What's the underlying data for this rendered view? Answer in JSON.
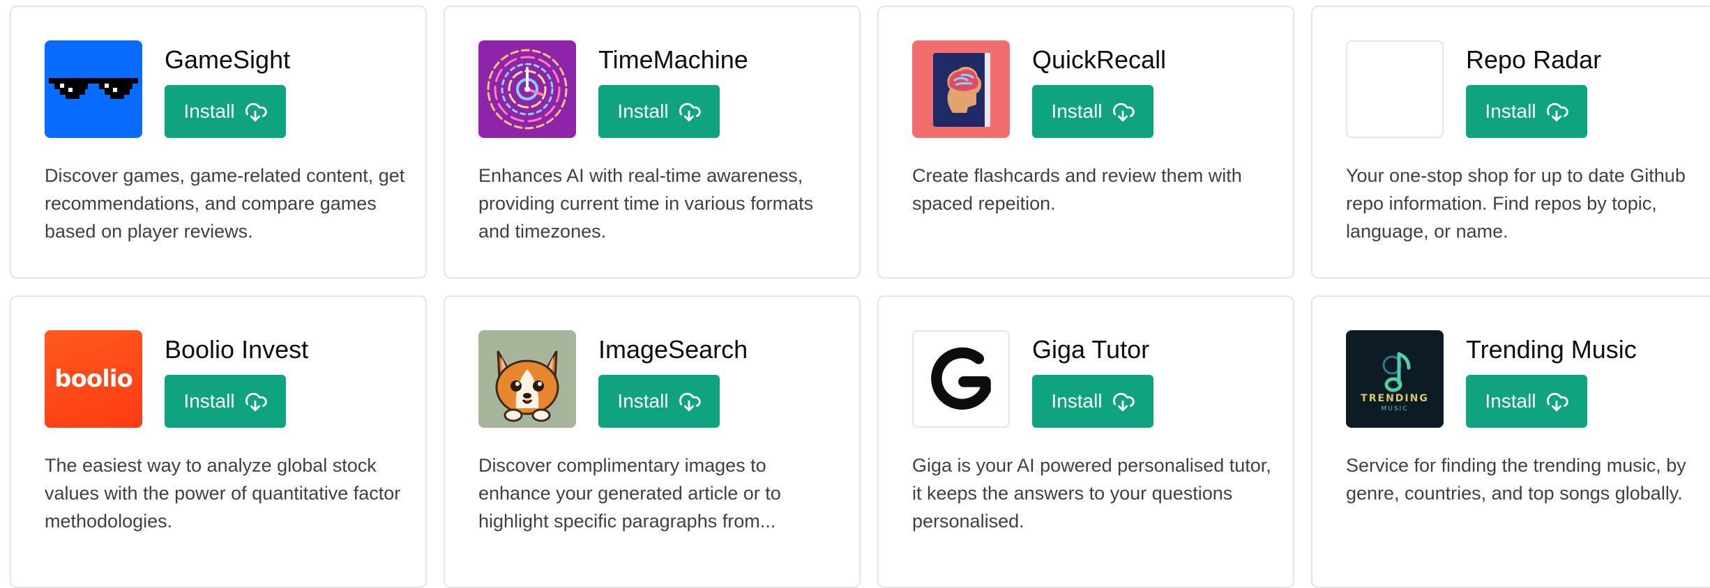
{
  "plugins": [
    {
      "name": "GameSight",
      "install_label": "Install",
      "description": "Discover games, game-related content, get recommendations, and compare games based on player reviews.",
      "logo": "pixel-sunglasses",
      "logo_bg": "#0a6cff"
    },
    {
      "name": "TimeMachine",
      "install_label": "Install",
      "description": "Enhances AI with real-time awareness, providing current time in various formats and timezones.",
      "logo": "circular-clock-pattern",
      "logo_bg": "#8e24aa"
    },
    {
      "name": "QuickRecall",
      "install_label": "Install",
      "description": "Create flashcards and review them with spaced repeition.",
      "logo": "brain-book",
      "logo_bg": "#f26d6d"
    },
    {
      "name": "Repo Radar",
      "install_label": "Install",
      "description": "Your one-stop shop for up to date Github repo information. Find repos by topic, language, or name.",
      "logo": "blank",
      "logo_bg": "#ffffff"
    },
    {
      "name": "Boolio Invest",
      "install_label": "Install",
      "description": "The easiest way to analyze global stock values with the power of quantitative factor methodologies.",
      "logo": "boolio-wordmark",
      "logo_text": "boolio",
      "logo_bg": "#ff4a1c"
    },
    {
      "name": "ImageSearch",
      "install_label": "Install",
      "description": "Discover complimentary images to enhance your generated article or to highlight specific paragraphs from...",
      "logo": "corgi-cartoon",
      "logo_bg": "#a7b59b"
    },
    {
      "name": "Giga Tutor",
      "install_label": "Install",
      "description": "Giga is your AI powered personalised tutor, it keeps the answers to your questions personalised.",
      "logo": "g-letter",
      "logo_bg": "#ffffff"
    },
    {
      "name": "Trending Music",
      "install_label": "Install",
      "description": "Service for finding the trending music, by genre, countries, and top songs globally.",
      "logo": "music-note",
      "logo_text": "TRENDING",
      "logo_subtext": "MUSIC",
      "logo_bg": "#0d1b25"
    }
  ],
  "colors": {
    "install_button": "#10a37f",
    "card_border": "#e5e5e7"
  }
}
